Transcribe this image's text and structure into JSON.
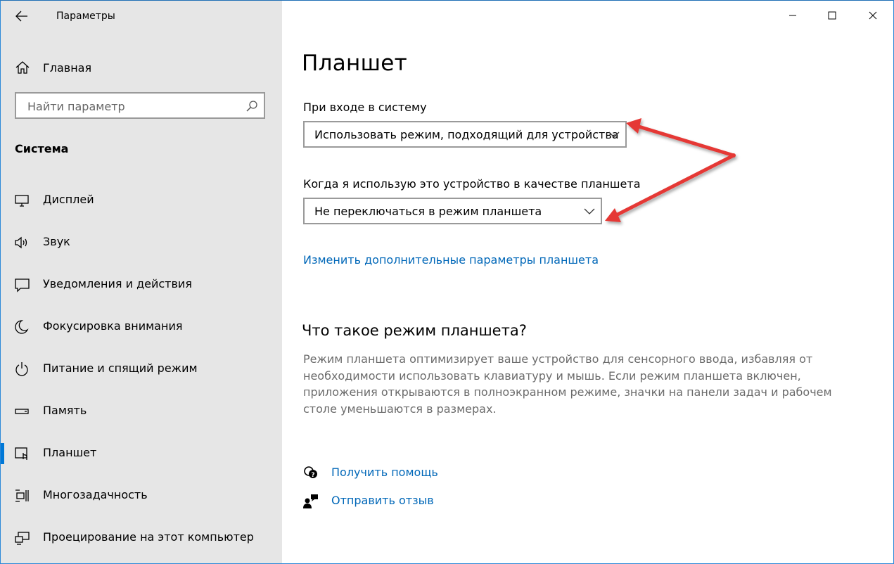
{
  "window": {
    "title": "Параметры",
    "accent_color": "#0078d7",
    "link_color": "#0067b8",
    "annotation_color": "#e53935"
  },
  "sidebar": {
    "home_label": "Главная",
    "search_placeholder": "Найти параметр",
    "section_title": "Система",
    "items": [
      {
        "label": "Дисплей",
        "icon": "display-icon",
        "active": false
      },
      {
        "label": "Звук",
        "icon": "speaker-icon",
        "active": false
      },
      {
        "label": "Уведомления и действия",
        "icon": "notification-icon",
        "active": false
      },
      {
        "label": "Фокусировка внимания",
        "icon": "moon-icon",
        "active": false
      },
      {
        "label": "Питание и спящий режим",
        "icon": "power-icon",
        "active": false
      },
      {
        "label": "Память",
        "icon": "storage-icon",
        "active": false
      },
      {
        "label": "Планшет",
        "icon": "tablet-icon",
        "active": true
      },
      {
        "label": "Многозадачность",
        "icon": "multitasking-icon",
        "active": false
      },
      {
        "label": "Проецирование на этот компьютер",
        "icon": "projecting-icon",
        "active": false
      }
    ]
  },
  "main": {
    "title": "Планшет",
    "signin_label": "При входе в систему",
    "signin_value": "Использовать режим, подходящий для устройства",
    "tablet_use_label": "Когда я использую это устройство в качестве планшета",
    "tablet_use_value": "Не переключаться в режим планшета",
    "advanced_link": "Изменить дополнительные параметры планшета",
    "about_title": "Что такое режим планшета?",
    "about_text": "Режим планшета оптимизирует ваше устройство для сенсорного ввода, избавляя от необходимости использовать клавиатуру и мышь. Если режим планшета включен, приложения открываются в полноэкранном режиме, значки на панели задач и рабочем столе уменьшаются в размерах.",
    "get_help": "Получить помощь",
    "send_feedback": "Отправить отзыв"
  }
}
